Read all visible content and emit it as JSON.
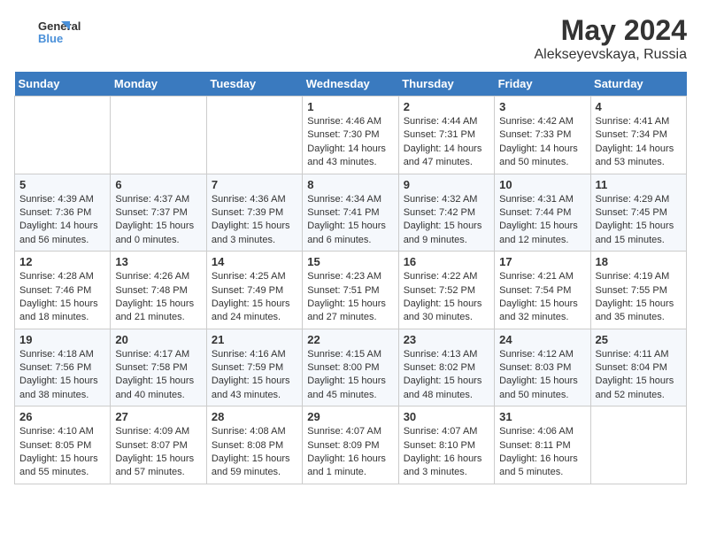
{
  "header": {
    "logo_line1": "General",
    "logo_line2": "Blue",
    "title": "May 2024",
    "subtitle": "Alekseyevskaya, Russia"
  },
  "weekdays": [
    "Sunday",
    "Monday",
    "Tuesday",
    "Wednesday",
    "Thursday",
    "Friday",
    "Saturday"
  ],
  "weeks": [
    [
      {
        "day": "",
        "info": ""
      },
      {
        "day": "",
        "info": ""
      },
      {
        "day": "",
        "info": ""
      },
      {
        "day": "1",
        "info": "Sunrise: 4:46 AM\nSunset: 7:30 PM\nDaylight: 14 hours\nand 43 minutes."
      },
      {
        "day": "2",
        "info": "Sunrise: 4:44 AM\nSunset: 7:31 PM\nDaylight: 14 hours\nand 47 minutes."
      },
      {
        "day": "3",
        "info": "Sunrise: 4:42 AM\nSunset: 7:33 PM\nDaylight: 14 hours\nand 50 minutes."
      },
      {
        "day": "4",
        "info": "Sunrise: 4:41 AM\nSunset: 7:34 PM\nDaylight: 14 hours\nand 53 minutes."
      }
    ],
    [
      {
        "day": "5",
        "info": "Sunrise: 4:39 AM\nSunset: 7:36 PM\nDaylight: 14 hours\nand 56 minutes."
      },
      {
        "day": "6",
        "info": "Sunrise: 4:37 AM\nSunset: 7:37 PM\nDaylight: 15 hours\nand 0 minutes."
      },
      {
        "day": "7",
        "info": "Sunrise: 4:36 AM\nSunset: 7:39 PM\nDaylight: 15 hours\nand 3 minutes."
      },
      {
        "day": "8",
        "info": "Sunrise: 4:34 AM\nSunset: 7:41 PM\nDaylight: 15 hours\nand 6 minutes."
      },
      {
        "day": "9",
        "info": "Sunrise: 4:32 AM\nSunset: 7:42 PM\nDaylight: 15 hours\nand 9 minutes."
      },
      {
        "day": "10",
        "info": "Sunrise: 4:31 AM\nSunset: 7:44 PM\nDaylight: 15 hours\nand 12 minutes."
      },
      {
        "day": "11",
        "info": "Sunrise: 4:29 AM\nSunset: 7:45 PM\nDaylight: 15 hours\nand 15 minutes."
      }
    ],
    [
      {
        "day": "12",
        "info": "Sunrise: 4:28 AM\nSunset: 7:46 PM\nDaylight: 15 hours\nand 18 minutes."
      },
      {
        "day": "13",
        "info": "Sunrise: 4:26 AM\nSunset: 7:48 PM\nDaylight: 15 hours\nand 21 minutes."
      },
      {
        "day": "14",
        "info": "Sunrise: 4:25 AM\nSunset: 7:49 PM\nDaylight: 15 hours\nand 24 minutes."
      },
      {
        "day": "15",
        "info": "Sunrise: 4:23 AM\nSunset: 7:51 PM\nDaylight: 15 hours\nand 27 minutes."
      },
      {
        "day": "16",
        "info": "Sunrise: 4:22 AM\nSunset: 7:52 PM\nDaylight: 15 hours\nand 30 minutes."
      },
      {
        "day": "17",
        "info": "Sunrise: 4:21 AM\nSunset: 7:54 PM\nDaylight: 15 hours\nand 32 minutes."
      },
      {
        "day": "18",
        "info": "Sunrise: 4:19 AM\nSunset: 7:55 PM\nDaylight: 15 hours\nand 35 minutes."
      }
    ],
    [
      {
        "day": "19",
        "info": "Sunrise: 4:18 AM\nSunset: 7:56 PM\nDaylight: 15 hours\nand 38 minutes."
      },
      {
        "day": "20",
        "info": "Sunrise: 4:17 AM\nSunset: 7:58 PM\nDaylight: 15 hours\nand 40 minutes."
      },
      {
        "day": "21",
        "info": "Sunrise: 4:16 AM\nSunset: 7:59 PM\nDaylight: 15 hours\nand 43 minutes."
      },
      {
        "day": "22",
        "info": "Sunrise: 4:15 AM\nSunset: 8:00 PM\nDaylight: 15 hours\nand 45 minutes."
      },
      {
        "day": "23",
        "info": "Sunrise: 4:13 AM\nSunset: 8:02 PM\nDaylight: 15 hours\nand 48 minutes."
      },
      {
        "day": "24",
        "info": "Sunrise: 4:12 AM\nSunset: 8:03 PM\nDaylight: 15 hours\nand 50 minutes."
      },
      {
        "day": "25",
        "info": "Sunrise: 4:11 AM\nSunset: 8:04 PM\nDaylight: 15 hours\nand 52 minutes."
      }
    ],
    [
      {
        "day": "26",
        "info": "Sunrise: 4:10 AM\nSunset: 8:05 PM\nDaylight: 15 hours\nand 55 minutes."
      },
      {
        "day": "27",
        "info": "Sunrise: 4:09 AM\nSunset: 8:07 PM\nDaylight: 15 hours\nand 57 minutes."
      },
      {
        "day": "28",
        "info": "Sunrise: 4:08 AM\nSunset: 8:08 PM\nDaylight: 15 hours\nand 59 minutes."
      },
      {
        "day": "29",
        "info": "Sunrise: 4:07 AM\nSunset: 8:09 PM\nDaylight: 16 hours\nand 1 minute."
      },
      {
        "day": "30",
        "info": "Sunrise: 4:07 AM\nSunset: 8:10 PM\nDaylight: 16 hours\nand 3 minutes."
      },
      {
        "day": "31",
        "info": "Sunrise: 4:06 AM\nSunset: 8:11 PM\nDaylight: 16 hours\nand 5 minutes."
      },
      {
        "day": "",
        "info": ""
      }
    ]
  ]
}
